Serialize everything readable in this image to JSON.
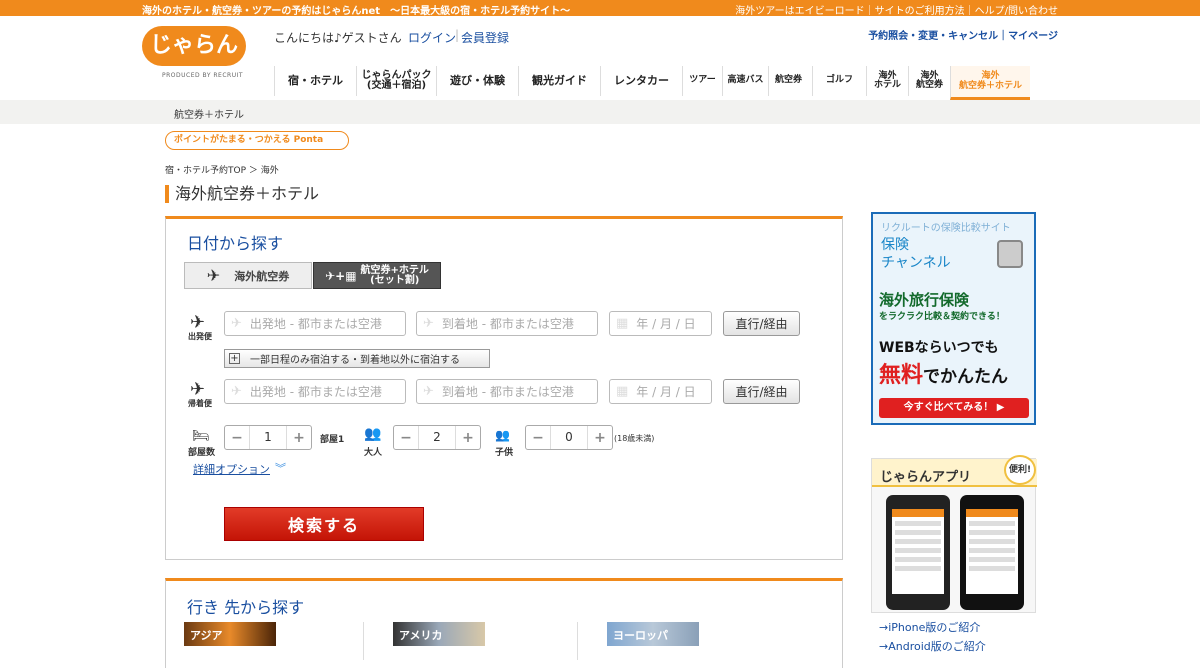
{
  "topbar": {
    "left_text": "海外のホテル・航空券・ツアーの予約はじゃらんnet　〜日本最大級の宿・ホテル予約サイト〜",
    "right_text": "海外ツアーはエイビーロード｜サイトのご利用方法｜ヘルプ/問い合わせ"
  },
  "header": {
    "logo_text": "じゃらん",
    "produced_by": "PRODUCED BY RECRUIT",
    "greeting": "こんにちは♪ゲストさん",
    "login": "ログイン",
    "register": "会員登録",
    "right_links": "予約照会・変更・キャンセル｜マイページ"
  },
  "nav": {
    "items": [
      {
        "label": "宿・ホテル"
      },
      {
        "label": "じゃらんパック\n(交通＋宿泊)"
      },
      {
        "label": "遊び・体験"
      },
      {
        "label": "観光ガイド"
      },
      {
        "label": "レンタカー"
      },
      {
        "label": "ツアー"
      },
      {
        "label": "高速バス"
      },
      {
        "label": "航空券"
      },
      {
        "label": "ゴルフ"
      },
      {
        "label": "海外\nホテル"
      },
      {
        "label": "海外\n航空券"
      },
      {
        "label": "海外\n航空券＋ホテル"
      }
    ]
  },
  "breadcrumb_top": "航空券＋ホテル",
  "ponta_banner": "ポイントがたまる・つかえる Ponta",
  "breadcrumb": "宿・ホテル予約TOP ＞ 海外",
  "page_title": "海外航空券＋ホテル",
  "search": {
    "title": "日付から探す",
    "tab_flight": "海外航空券",
    "tab_package": "航空券+ホテル\n(セット割)",
    "outbound_label": "出発便",
    "return_label": "帰着便",
    "departure_placeholder": "出発地 - 都市または空港",
    "arrival_placeholder": "到着地 - 都市または空港",
    "date_placeholder": "年 / 月 / 日",
    "route_button": "直行/経由",
    "partial_stay": "一部日程のみ宿泊する・到着地以外に宿泊する",
    "rooms_label": "部屋数",
    "rooms_value": "1",
    "rooms_unit": "部屋1",
    "adults_label": "大人",
    "adults_value": "2",
    "children_label": "子供",
    "children_value": "0",
    "children_note": "(18歳未満)",
    "detail_options": "詳細オプション",
    "search_button": "検索する"
  },
  "destinations": {
    "title": "行き 先から探す",
    "regions": [
      "アジア",
      "アメリカ",
      "ヨーロッパ"
    ]
  },
  "ad_insurance": {
    "line1": "リクルートの保険比較サイト",
    "line2": "保険\nチャンネル",
    "line3": "海外旅行保険",
    "line4": "をラクラク比較＆契約できる！",
    "line5": "WEBならいつでも",
    "free": "無料",
    "easy": "でかんたん",
    "button": "今すぐ比べてみる！"
  },
  "app": {
    "title": "じゃらんアプリ",
    "badge": "便利!",
    "iphone_link": "→iPhone版のご紹介",
    "android_link": "→Android版のご紹介"
  },
  "colors": {
    "brand_orange": "#f08a1c",
    "link_blue": "#1a4fa0",
    "search_red": "#d42010"
  }
}
